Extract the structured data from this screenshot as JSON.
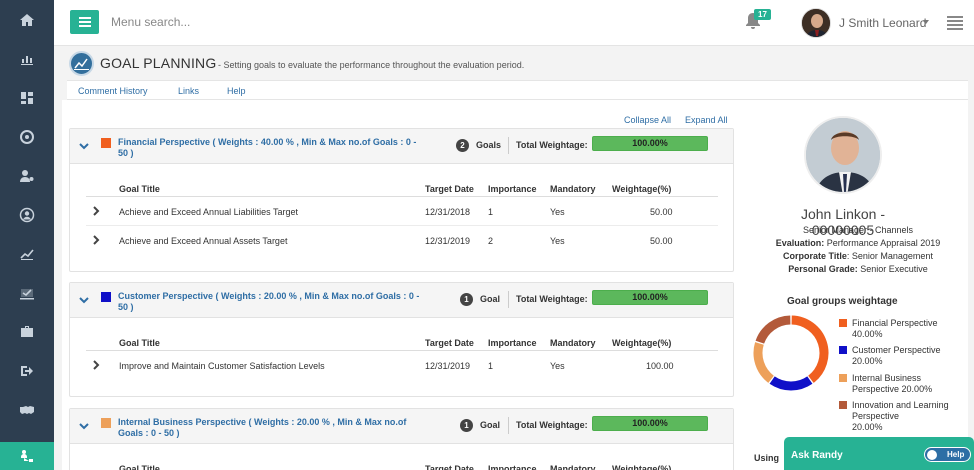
{
  "topbar": {
    "search_placeholder": "Menu search...",
    "notification_count": "17",
    "user_name": "J Smith Leonard"
  },
  "page": {
    "title": "GOAL PLANNING",
    "subtitle": "- Setting goals to evaluate the performance throughout the evaluation period."
  },
  "subnav": [
    "Comment History",
    "Links",
    "Help"
  ],
  "controls": {
    "collapse_all": "Collapse All",
    "expand_all": "Expand All"
  },
  "columns": [
    "Goal Title",
    "Target Date",
    "Importance",
    "Mandatory",
    "Weightage(%)"
  ],
  "sections": [
    {
      "title": "Financial Perspective ( Weights : 40.00 % , Min & Max no.of Goals : 0 - 50 )",
      "color": "#f05f1f",
      "goal_count": "2",
      "goal_word": "Goals",
      "weightage_label": "Total Weightage:",
      "weightage_value": "100.00%",
      "rows": [
        [
          "Achieve and Exceed Annual Liabilities Target",
          "12/31/2018",
          "1",
          "Yes",
          "50.00"
        ],
        [
          "Achieve and Exceed Annual Assets Target",
          "12/31/2019",
          "2",
          "Yes",
          "50.00"
        ]
      ]
    },
    {
      "title": "Customer Perspective ( Weights : 20.00 % , Min & Max no.of Goals : 0 - 50 )",
      "color": "#1010c8",
      "goal_count": "1",
      "goal_word": "Goal",
      "weightage_label": "Total Weightage:",
      "weightage_value": "100.00%",
      "rows": [
        [
          "Improve and Maintain Customer Satisfaction Levels",
          "12/31/2019",
          "1",
          "Yes",
          "100.00"
        ]
      ]
    },
    {
      "title": "Internal Business Perspective ( Weights : 20.00 % , Min & Max no.of Goals : 0 - 50 )",
      "color": "#eda05a",
      "goal_count": "1",
      "goal_word": "Goal",
      "weightage_label": "Total Weightage:",
      "weightage_value": "100.00%",
      "rows": []
    }
  ],
  "profile": {
    "name": "John Linkon",
    "id": "- 00000005",
    "role": "Senior Manager - Channels",
    "evaluation_label": "Evaluation:",
    "evaluation_value": " Performance Appraisal 2019",
    "corporate_label": "Corporate Title",
    "corporate_value": ": Senior Management",
    "grade_label": "Personal Grade:",
    "grade_value": " Senior Executive"
  },
  "goal_groups": {
    "title": "Goal groups weightage",
    "items": [
      {
        "label": "Financial Perspective",
        "percent": "40.00%",
        "value": 40,
        "color": "#f05f1f"
      },
      {
        "label": "Customer Perspective",
        "percent": "20.00%",
        "value": 20,
        "color": "#1010c8"
      },
      {
        "label": "Internal Business Perspective",
        "percent": "20.00%",
        "value": 20,
        "color": "#eda05a"
      },
      {
        "label": "Innovation and Learning Perspective",
        "percent": "20.00%",
        "value": 20,
        "color": "#b35a3a"
      }
    ]
  },
  "using_label": "Using",
  "ask_randy": {
    "label": "Ask Randy",
    "help_label": "Help"
  },
  "colors": {
    "accent": "#27b294",
    "sidebar": "#2d3e50",
    "link": "#2f6ea5",
    "progress": "#5cb85c"
  }
}
